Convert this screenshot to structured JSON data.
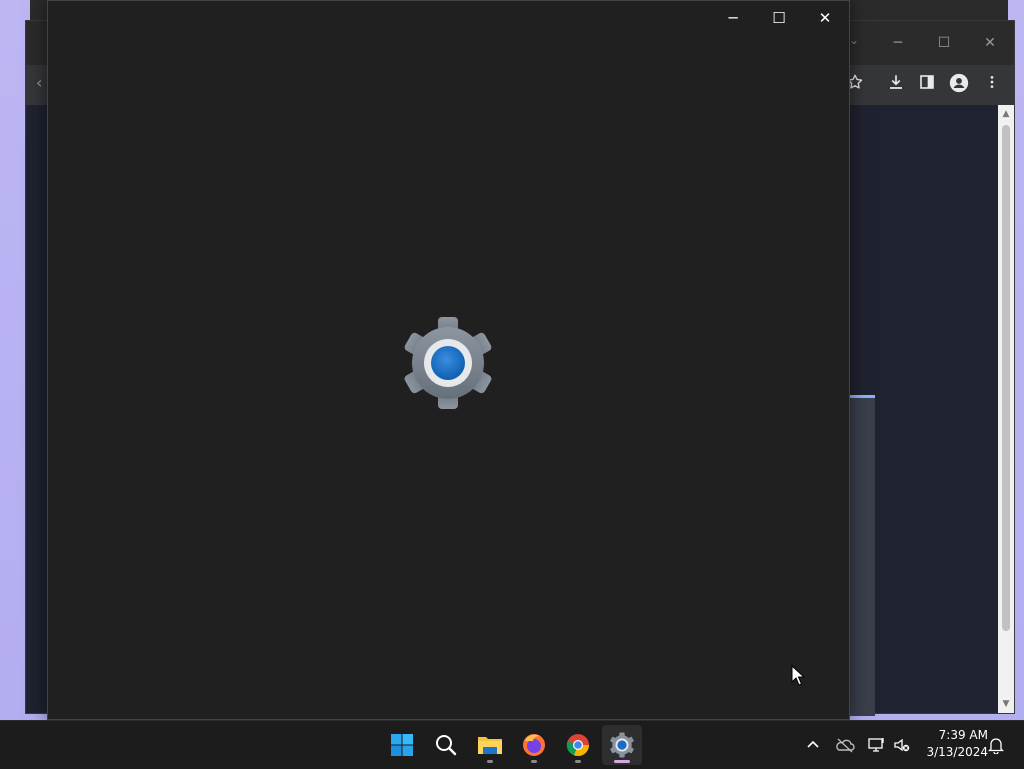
{
  "desktop": {
    "background": "#b8b3f0"
  },
  "settings_window": {
    "controls": {
      "minimize": "─",
      "maximize": "☐",
      "close": "✕"
    },
    "splash_icon": "settings-gear-icon",
    "accent": "#0f6cbd"
  },
  "browser_window": {
    "controls": {
      "minimize": "─",
      "maximize": "☐",
      "close": "✕"
    },
    "toolbar_icons": [
      "bookmark-star-icon",
      "download-icon",
      "side-panel-icon",
      "profile-icon",
      "menu-icon"
    ]
  },
  "taskbar": {
    "apps": [
      "start-icon",
      "search-icon",
      "file-explorer-icon",
      "firefox-icon",
      "chrome-icon",
      "settings-icon"
    ],
    "active_app": "settings-icon",
    "tray": [
      "show-hidden-icons-chevron",
      "onedrive-icon",
      "network-icon",
      "volume-muted-icon",
      "notifications-bell-icon"
    ],
    "clock": {
      "time": "7:39 AM",
      "date": "3/13/2024"
    }
  }
}
